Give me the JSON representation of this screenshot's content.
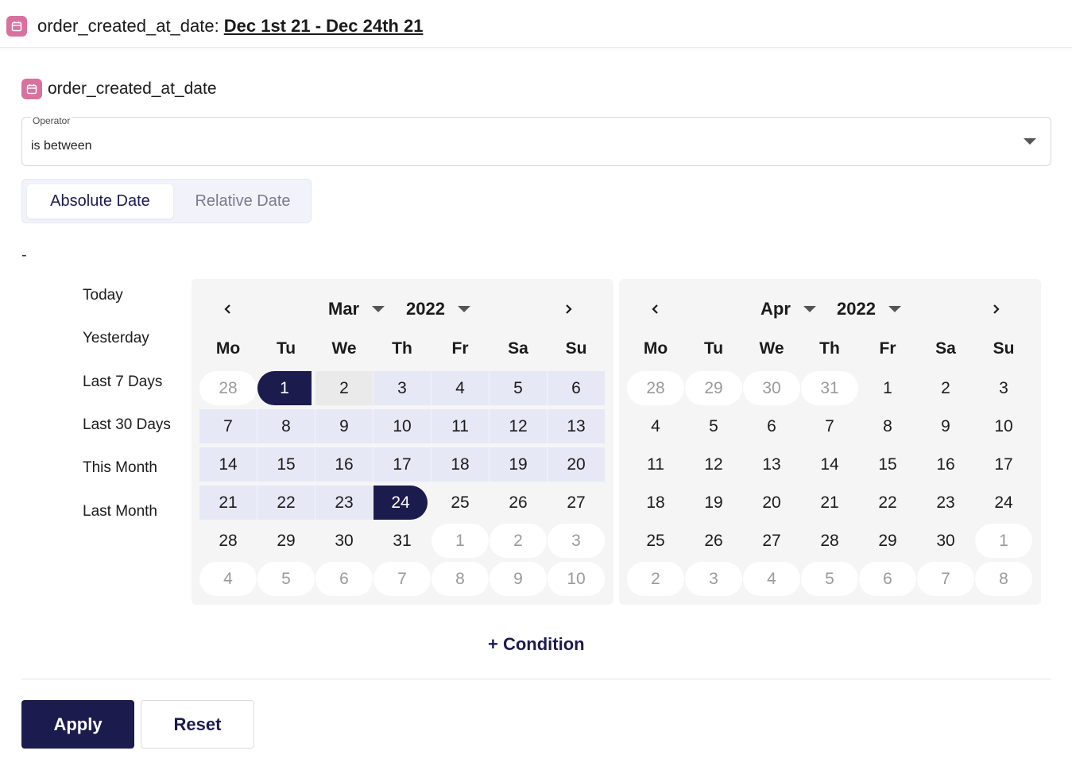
{
  "header": {
    "field_label": "order_created_at_date:",
    "range_label": "Dec 1st 21 - Dec 24th 21",
    "icon": "calendar-icon"
  },
  "filter": {
    "field_name": "order_created_at_date",
    "icon": "calendar-icon",
    "operator_label": "Operator",
    "operator_value": "is between"
  },
  "date_mode": {
    "absolute_label": "Absolute Date",
    "relative_label": "Relative Date",
    "active": "absolute"
  },
  "range_separator": "-",
  "shortcuts": [
    "Today",
    "Yesterday",
    "Last 7 Days",
    "Last 30 Days",
    "This Month",
    "Last Month"
  ],
  "weekdays": [
    "Mo",
    "Tu",
    "We",
    "Th",
    "Fr",
    "Sa",
    "Su"
  ],
  "calendars": [
    {
      "month": "Mar",
      "year": "2022",
      "weeks": [
        [
          "28",
          "1",
          "2",
          "3",
          "4",
          "5",
          "6"
        ],
        [
          "7",
          "8",
          "9",
          "10",
          "11",
          "12",
          "13"
        ],
        [
          "14",
          "15",
          "16",
          "17",
          "18",
          "19",
          "20"
        ],
        [
          "21",
          "22",
          "23",
          "24",
          "25",
          "26",
          "27"
        ],
        [
          "28",
          "29",
          "30",
          "31",
          "1",
          "2",
          "3"
        ],
        [
          "4",
          "5",
          "6",
          "7",
          "8",
          "9",
          "10"
        ]
      ]
    },
    {
      "month": "Apr",
      "year": "2022",
      "weeks": [
        [
          "28",
          "29",
          "30",
          "31",
          "1",
          "2",
          "3"
        ],
        [
          "4",
          "5",
          "6",
          "7",
          "8",
          "9",
          "10"
        ],
        [
          "11",
          "12",
          "13",
          "14",
          "15",
          "16",
          "17"
        ],
        [
          "18",
          "19",
          "20",
          "21",
          "22",
          "23",
          "24"
        ],
        [
          "25",
          "26",
          "27",
          "28",
          "29",
          "30",
          "1"
        ],
        [
          "2",
          "3",
          "4",
          "5",
          "6",
          "7",
          "8"
        ]
      ]
    }
  ],
  "selection": {
    "start": "1",
    "end": "24"
  },
  "add_condition_label": "+ Condition",
  "actions": {
    "apply_label": "Apply",
    "reset_label": "Reset"
  },
  "colors": {
    "primary": "#1c1b4d",
    "range_fill": "#e6e8f5",
    "calendar_badge": "#d9719e"
  }
}
